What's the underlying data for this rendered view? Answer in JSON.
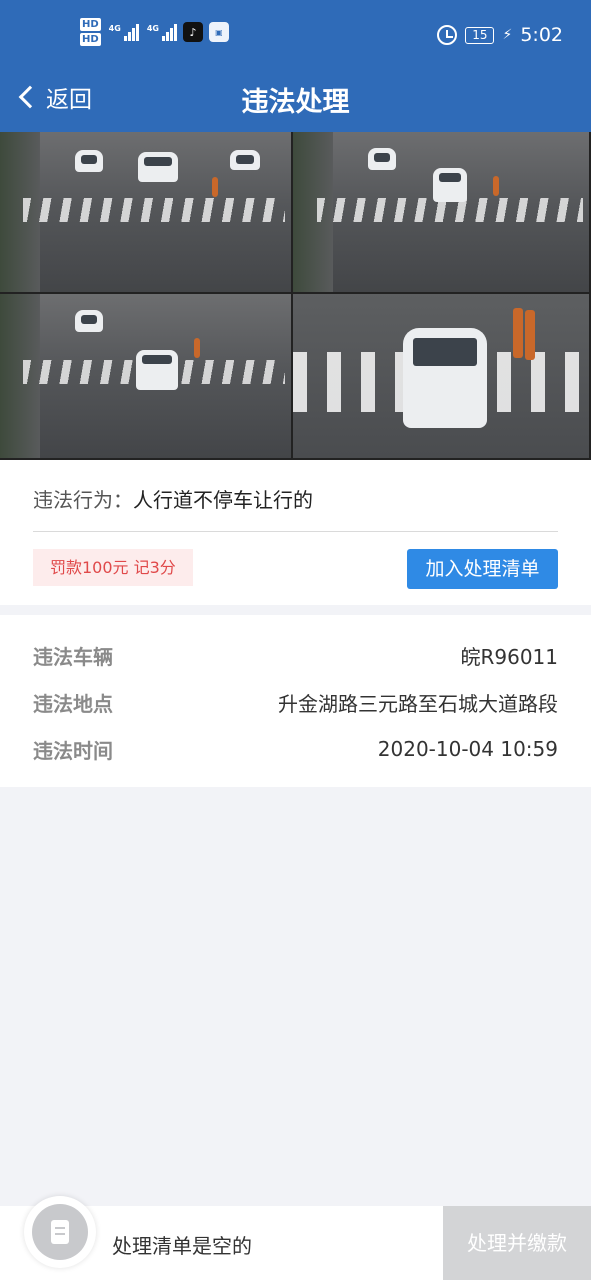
{
  "status_bar": {
    "hd1": "HD",
    "hd2": "HD",
    "net1": "4G",
    "net2": "4G",
    "battery": "15",
    "time": "5:02"
  },
  "nav": {
    "back_label": "返回",
    "title": "违法处理"
  },
  "violation": {
    "behavior_label": "违法行为：",
    "behavior_value": "人行道不停车让行的",
    "penalty": "罚款100元 记3分",
    "add_button": "加入处理清单"
  },
  "details": [
    {
      "key": "违法车辆",
      "value": "皖R96011"
    },
    {
      "key": "违法地点",
      "value": "升金湖路三元路至石城大道路段"
    },
    {
      "key": "违法时间",
      "value": "2020-10-04 10:59"
    }
  ],
  "bottom": {
    "empty_text": "处理清单是空的",
    "pay_button": "处理并缴款"
  },
  "colors": {
    "primary": "#2f6bb8",
    "button_blue": "#2f8ae5",
    "penalty_red": "#e0494a"
  }
}
